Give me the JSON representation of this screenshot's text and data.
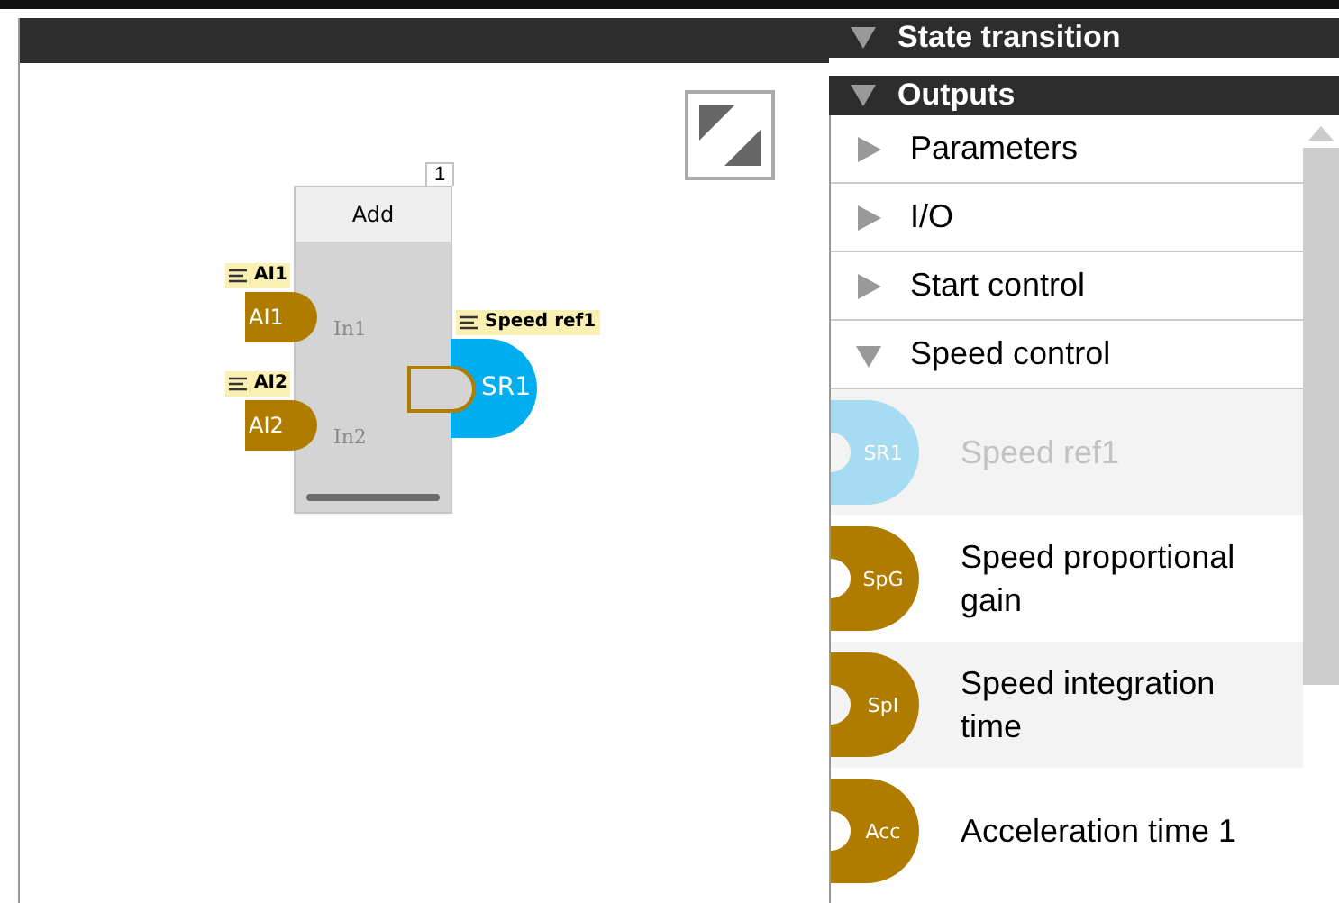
{
  "canvas": {
    "block": {
      "title": "Add",
      "number": "1",
      "inputs": [
        {
          "tag": "AI1",
          "port": "AI1",
          "pin": "In1",
          "color": "#b07c00"
        },
        {
          "tag": "AI2",
          "port": "AI2",
          "pin": "In2",
          "color": "#b07c00"
        }
      ],
      "output": {
        "tag": "Speed ref1",
        "port": "SR1",
        "color": "#00aeef"
      }
    }
  },
  "panel": {
    "sections": [
      {
        "title": "State transition",
        "expanded": true
      },
      {
        "title": "Outputs",
        "expanded": true
      }
    ],
    "categories": [
      {
        "label": "Parameters",
        "expanded": false
      },
      {
        "label": "I/O",
        "expanded": false
      },
      {
        "label": "Start control",
        "expanded": false
      },
      {
        "label": "Speed control",
        "expanded": true
      }
    ],
    "outputs": [
      {
        "abbr": "SR1",
        "label": "Speed ref1",
        "disabled": true,
        "color": "#a6dcf2"
      },
      {
        "abbr": "SpG",
        "label": "Speed proportional gain",
        "disabled": false,
        "color": "#b07c00"
      },
      {
        "abbr": "SpI",
        "label": "Speed integration time",
        "disabled": false,
        "color": "#b07c00"
      },
      {
        "abbr": "Acc",
        "label": "Acceleration time 1",
        "disabled": false,
        "color": "#b07c00"
      }
    ]
  }
}
